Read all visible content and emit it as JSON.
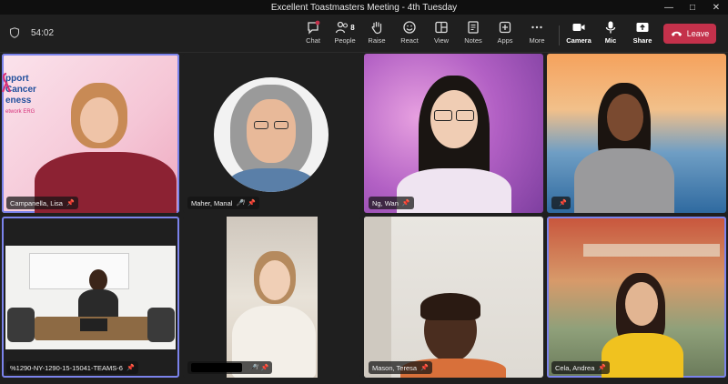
{
  "window": {
    "title": "Excellent Toastmasters Meeting - 4th Tuesday"
  },
  "timer": {
    "value": "54:02"
  },
  "toolbar": {
    "chat": "Chat",
    "people": "People",
    "people_count": "8",
    "raise": "Raise",
    "react": "React",
    "view": "View",
    "notes": "Notes",
    "apps": "Apps",
    "more": "More",
    "camera": "Camera",
    "mic": "Mic",
    "share": "Share",
    "leave": "Leave"
  },
  "banner": {
    "line1": "pport",
    "line2": "Cancer",
    "line3": "eness",
    "line4": "etwork ERG"
  },
  "participants": [
    {
      "name": "Campanella, Lisa",
      "muted": false,
      "pinned": true
    },
    {
      "name": "Maher, Manal",
      "muted": true,
      "pinned": true
    },
    {
      "name": "Ng, Wan",
      "muted": false,
      "pinned": true
    },
    {
      "name": "",
      "muted": false,
      "pinned": true
    },
    {
      "name": "%1290-NY-1290-15-15041-TEAMS-6",
      "muted": false,
      "pinned": true
    },
    {
      "name": "",
      "muted": true,
      "pinned": true
    },
    {
      "name": "Mason, Teresa",
      "muted": false,
      "pinned": true
    },
    {
      "name": "Cela, Andrea",
      "muted": false,
      "pinned": true
    }
  ],
  "colors": {
    "accent": "#7b83eb",
    "leave": "#c4314b",
    "pink": "#d6317a"
  }
}
